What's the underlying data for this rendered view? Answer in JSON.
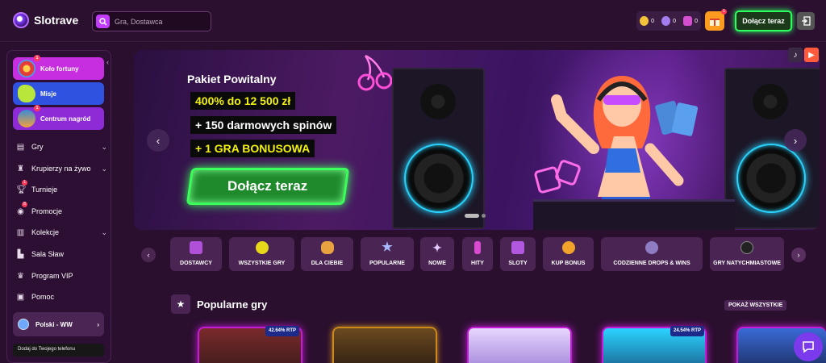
{
  "header": {
    "brand": "Slotrave",
    "search_placeholder": "Gra, Dostawca",
    "wallet": [
      "0",
      "0",
      "0"
    ],
    "join_label": "Dołącz teraz",
    "gift_badge": "1"
  },
  "sidebar": {
    "promo": [
      {
        "label": "Koło fortuny",
        "badge": "1",
        "color": "#c72ee0"
      },
      {
        "label": "Misje",
        "badge": "",
        "color": "#2f52e0"
      },
      {
        "label": "Centrum nagród",
        "badge": "1",
        "color": "#8e2bd6"
      }
    ],
    "items": [
      {
        "label": "Gry",
        "icon": "cards-icon",
        "chev": "⌄",
        "badge": ""
      },
      {
        "label": "Krupierzy na żywo",
        "icon": "dealer-icon",
        "chev": "⌄",
        "badge": ""
      },
      {
        "label": "Turnieje",
        "icon": "trophy-icon",
        "chev": "",
        "badge": "1"
      },
      {
        "label": "Promocje",
        "icon": "bell-icon",
        "chev": "",
        "badge": "8"
      },
      {
        "label": "Kolekcje",
        "icon": "collection-icon",
        "chev": "⌄",
        "badge": ""
      },
      {
        "label": "Sala Sław",
        "icon": "podium-icon",
        "chev": "",
        "badge": ""
      },
      {
        "label": "Program VIP",
        "icon": "crown-icon",
        "chev": "",
        "badge": ""
      },
      {
        "label": "Pomoc",
        "icon": "help-icon",
        "chev": "",
        "badge": ""
      }
    ],
    "language": "Polski - WW",
    "phone_text": "Dodaj do Twojego telefonu"
  },
  "banner": {
    "title": "Pakiet Powitalny",
    "line1_highlight": "400% do 12 500 zł",
    "line2": "+ 150 darmowych spinów",
    "line3": "+ 1 GRA BONUSOWA",
    "cta": "Dołącz teraz"
  },
  "categories": [
    {
      "label": "DOSTAWCY",
      "icon": "folder-icon",
      "color": "#b04fd8"
    },
    {
      "label": "WSZYSTKIE GRY",
      "icon": "smiley-icon",
      "color": "#e7d81a"
    },
    {
      "label": "DLA CIEBIE",
      "icon": "finger-icon",
      "color": "#e8a340"
    },
    {
      "label": "POPULARNE",
      "icon": "star-icon",
      "color": "#8fa2ff"
    },
    {
      "label": "NOWE",
      "icon": "sparkle-icon",
      "color": "#d7b9ff"
    },
    {
      "label": "HITY",
      "icon": "joystick-icon",
      "color": "#d84bd1"
    },
    {
      "label": "SLOTY",
      "icon": "slot-icon",
      "color": "#b157e0"
    },
    {
      "label": "KUP BONUS",
      "icon": "coin-icon",
      "color": "#f1a22b"
    },
    {
      "label": "CODZIENNE DROPS & WINS",
      "icon": "drops-icon",
      "color": "#8e7cc3"
    },
    {
      "label": "GRY NATYCHMIASTOWE",
      "icon": "bomb-icon",
      "color": "#333"
    }
  ],
  "popular": {
    "title": "Popularne gry",
    "show_all": "POKAŻ WSZYSTKIE",
    "rtp": [
      "42.64% RTP",
      "24.54% RTP"
    ]
  }
}
